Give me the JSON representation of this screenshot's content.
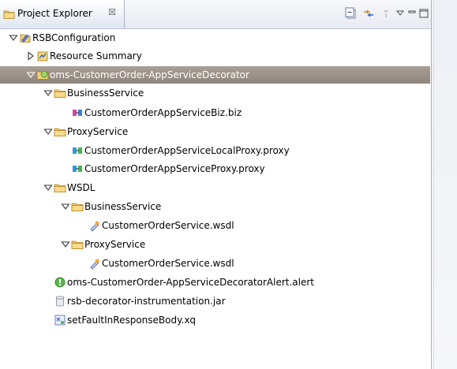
{
  "view": {
    "tab_label": "Project Explorer",
    "tab_close": "☒",
    "toolbar": [
      "collapse-all-icon",
      "link-with-editor-icon",
      "view-menu-icon",
      "minimize-icon",
      "maximize-icon"
    ]
  },
  "tree": [
    {
      "label": "RSBConfiguration",
      "icon": "project-icon",
      "expanded": true
    },
    {
      "label": "Resource Summary",
      "icon": "resource-summary-icon",
      "expanded": false
    },
    {
      "label": "oms-CustomerOrder-AppServiceDecorator",
      "icon": "project-folder-icon",
      "expanded": true,
      "selected": true
    },
    {
      "label": "BusinessService",
      "icon": "folder-icon",
      "expanded": true
    },
    {
      "label": "CustomerOrderAppServiceBiz.biz",
      "icon": "business-service-file-icon"
    },
    {
      "label": "ProxyService",
      "icon": "folder-icon",
      "expanded": true
    },
    {
      "label": "CustomerOrderAppServiceLocalProxy.proxy",
      "icon": "proxy-service-file-icon"
    },
    {
      "label": "CustomerOrderAppServiceProxy.proxy",
      "icon": "proxy-service-file-icon"
    },
    {
      "label": "WSDL",
      "icon": "folder-icon",
      "expanded": true
    },
    {
      "label": "BusinessService",
      "icon": "folder-icon",
      "expanded": true
    },
    {
      "label": "CustomerOrderService.wsdl",
      "icon": "wsdl-file-icon"
    },
    {
      "label": "ProxyService",
      "icon": "folder-icon",
      "expanded": true
    },
    {
      "label": "CustomerOrderService.wsdl",
      "icon": "wsdl-file-icon"
    },
    {
      "label": "oms-CustomerOrder-AppServiceDecoratorAlert.alert",
      "icon": "alert-file-icon"
    },
    {
      "label": "rsb-decorator-instrumentation.jar",
      "icon": "jar-file-icon"
    },
    {
      "label": "setFaultInResponseBody.xq",
      "icon": "xquery-file-icon"
    }
  ]
}
